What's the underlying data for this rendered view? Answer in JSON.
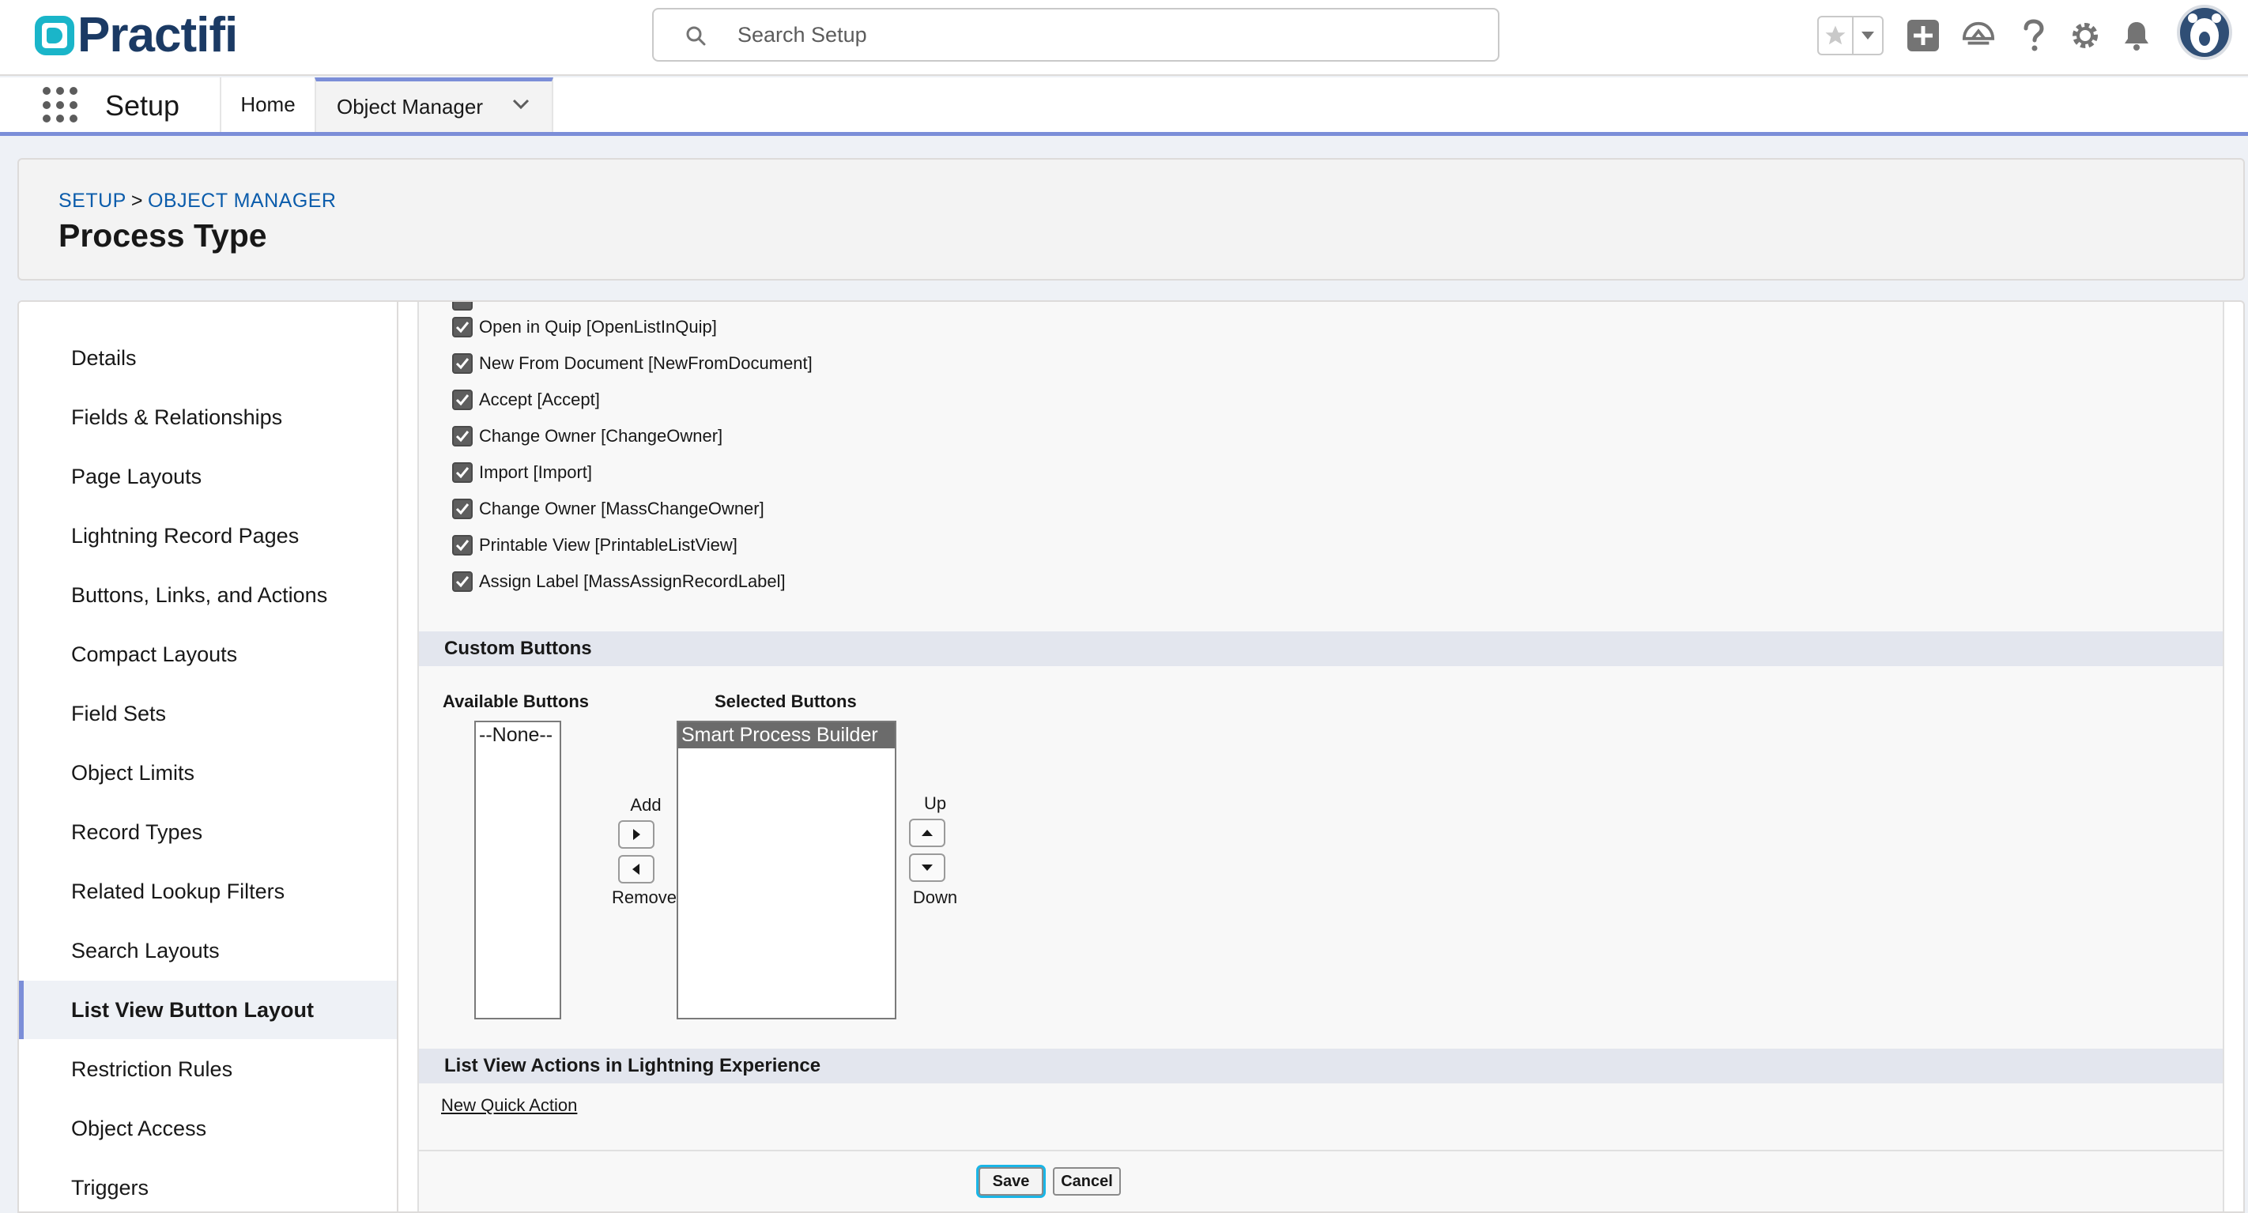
{
  "brand": {
    "name": "Practifi",
    "primary_color": "#1b3a64",
    "accent_color": "#1ab5c9"
  },
  "header": {
    "search_placeholder": "Search Setup"
  },
  "nav": {
    "app_name": "Setup",
    "tabs": [
      {
        "label": "Home"
      },
      {
        "label": "Object Manager",
        "active": true
      }
    ]
  },
  "page": {
    "breadcrumb": [
      "SETUP",
      "OBJECT MANAGER"
    ],
    "breadcrumb_separator": ">",
    "title": "Process Type"
  },
  "sidebar": {
    "items": [
      {
        "label": "Details"
      },
      {
        "label": "Fields & Relationships"
      },
      {
        "label": "Page Layouts"
      },
      {
        "label": "Lightning Record Pages"
      },
      {
        "label": "Buttons, Links, and Actions"
      },
      {
        "label": "Compact Layouts"
      },
      {
        "label": "Field Sets"
      },
      {
        "label": "Object Limits"
      },
      {
        "label": "Record Types"
      },
      {
        "label": "Related Lookup Filters"
      },
      {
        "label": "Search Layouts"
      },
      {
        "label": "List View Button Layout",
        "active": true
      },
      {
        "label": "Restriction Rules"
      },
      {
        "label": "Object Access"
      },
      {
        "label": "Triggers"
      }
    ]
  },
  "standard_buttons": [
    {
      "label": "Open in Quip [OpenListInQuip]",
      "checked": true
    },
    {
      "label": "New From Document [NewFromDocument]",
      "checked": true
    },
    {
      "label": "Accept [Accept]",
      "checked": true
    },
    {
      "label": "Change Owner [ChangeOwner]",
      "checked": true
    },
    {
      "label": "Import [Import]",
      "checked": true
    },
    {
      "label": "Change Owner [MassChangeOwner]",
      "checked": true
    },
    {
      "label": "Printable View [PrintableListView]",
      "checked": true
    },
    {
      "label": "Assign Label [MassAssignRecordLabel]",
      "checked": true
    }
  ],
  "custom_buttons": {
    "section_title": "Custom Buttons",
    "available_label": "Available Buttons",
    "selected_label": "Selected Buttons",
    "available": [
      "--None--"
    ],
    "selected": [
      "Smart Process Builder"
    ],
    "add_label": "Add",
    "remove_label": "Remove",
    "up_label": "Up",
    "down_label": "Down"
  },
  "lightning_actions": {
    "section_title": "List View Actions in Lightning Experience",
    "link": "New Quick Action"
  },
  "footer": {
    "save": "Save",
    "cancel": "Cancel"
  }
}
